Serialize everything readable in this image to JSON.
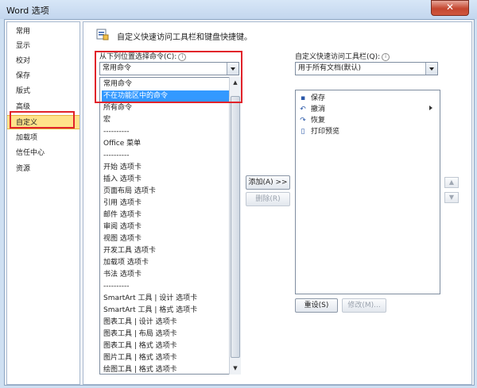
{
  "window": {
    "title": "Word 选项",
    "close_label": "✕"
  },
  "nav": {
    "items": [
      "常用",
      "显示",
      "校对",
      "保存",
      "版式",
      "高级",
      "自定义",
      "加载项",
      "信任中心",
      "资源"
    ],
    "selected": "自定义"
  },
  "header": {
    "text": "自定义快速访问工具栏和键盘快捷键。"
  },
  "left_panel": {
    "label": "从下列位置选择命令(C):",
    "dropdown_value": "常用命令",
    "options": [
      "常用命令",
      "不在功能区中的命令",
      "所有命令",
      "宏",
      "----------",
      "Office 菜单",
      "----------",
      "开始 选项卡",
      "插入 选项卡",
      "页面布局 选项卡",
      "引用 选项卡",
      "邮件 选项卡",
      "审阅 选项卡",
      "视图 选项卡",
      "开发工具 选项卡",
      "加载项 选项卡",
      "书法 选项卡",
      "----------",
      "SmartArt 工具 | 设计 选项卡",
      "SmartArt 工具 | 格式 选项卡",
      "图表工具 | 设计 选项卡",
      "图表工具 | 布局 选项卡",
      "图表工具 | 格式 选项卡",
      "图片工具 | 格式 选项卡",
      "绘图工具 | 格式 选项卡"
    ],
    "highlighted": "不在功能区中的命令"
  },
  "middle_buttons": {
    "add": "添加(A) >>",
    "remove": "删除(R)"
  },
  "right_panel": {
    "label": "自定义快速访问工具栏(Q):",
    "dropdown_value": "用于所有文档(默认)",
    "items": [
      {
        "icon": "save-icon",
        "label": "保存"
      },
      {
        "icon": "undo-icon",
        "label": "撤消"
      },
      {
        "icon": "redo-icon",
        "label": "恢复"
      },
      {
        "icon": "print-preview-icon",
        "label": "打印预览"
      }
    ],
    "reset": "重设(S)",
    "modify": "修改(M)..."
  },
  "colors": {
    "highlight": "#3399ff",
    "selected_nav": "#ffe28a",
    "annotation_red": "#e1232a"
  }
}
